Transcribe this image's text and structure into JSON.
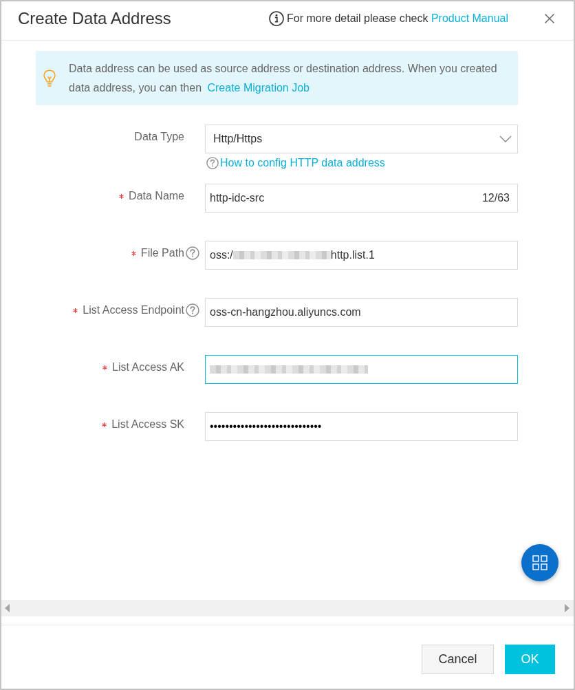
{
  "dialog": {
    "title": "Create Data Address",
    "header_note": {
      "text": "For more detail please check",
      "link": "Product Manual"
    }
  },
  "notice": {
    "text": "Data address can be used as source address or destination address. When you created data address, you can then",
    "link": "Create Migration Job"
  },
  "form": {
    "fields": [
      {
        "kind": "select",
        "label": "Data Type",
        "required": false,
        "help_icon": false,
        "focused": false,
        "redacted": false,
        "value": "Http/Https",
        "help_link": "How to config HTTP data address"
      },
      {
        "kind": "text",
        "label": "Data Name",
        "required": true,
        "help_icon": false,
        "focused": false,
        "redacted": false,
        "value": "http-idc-src",
        "counter": "12/63"
      },
      {
        "kind": "text",
        "label": "File Path",
        "required": true,
        "help_icon": true,
        "focused": false,
        "redacted": true,
        "value": "oss:/",
        "value_after": "http.list.1"
      },
      {
        "kind": "text",
        "label": "List Access Endpoint",
        "required": true,
        "help_icon": true,
        "focused": false,
        "redacted": false,
        "value": "oss-cn-hangzhou.aliyuncs.com"
      },
      {
        "kind": "text",
        "label": "List Access AK",
        "required": true,
        "help_icon": false,
        "focused": true,
        "redacted": true
      },
      {
        "kind": "password",
        "label": "List Access SK",
        "required": true,
        "help_icon": false,
        "focused": false,
        "redacted": false,
        "value": "•••••••••••••••••••••••••••••"
      }
    ]
  },
  "footer": {
    "buttons": [
      {
        "kind": "secondary",
        "label": "Cancel"
      },
      {
        "kind": "primary",
        "label": "OK"
      }
    ]
  }
}
